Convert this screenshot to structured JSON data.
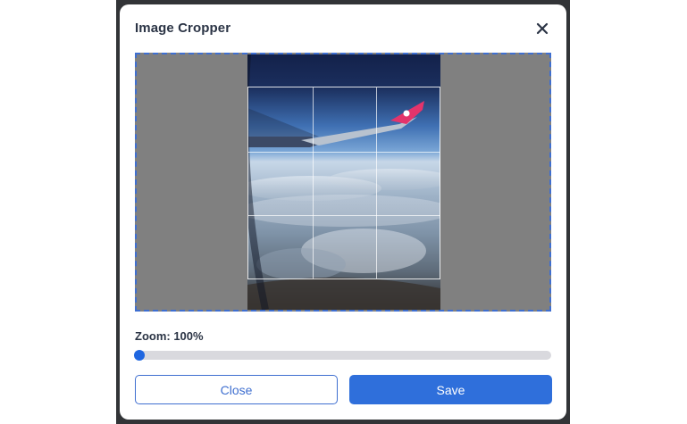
{
  "dialog": {
    "title": "Image Cropper",
    "close_icon": "close-icon"
  },
  "cropper": {
    "image_description_icon": "photo",
    "grid": "rule-of-thirds"
  },
  "zoom": {
    "label": "Zoom: 100%",
    "value_percent": 100,
    "slider_fraction": 0.0
  },
  "actions": {
    "close_label": "Close",
    "save_label": "Save"
  },
  "colors": {
    "accent": "#2f6fdb",
    "title_text": "#2b3445",
    "crop_background": "#808080",
    "overlay": "#323437"
  }
}
